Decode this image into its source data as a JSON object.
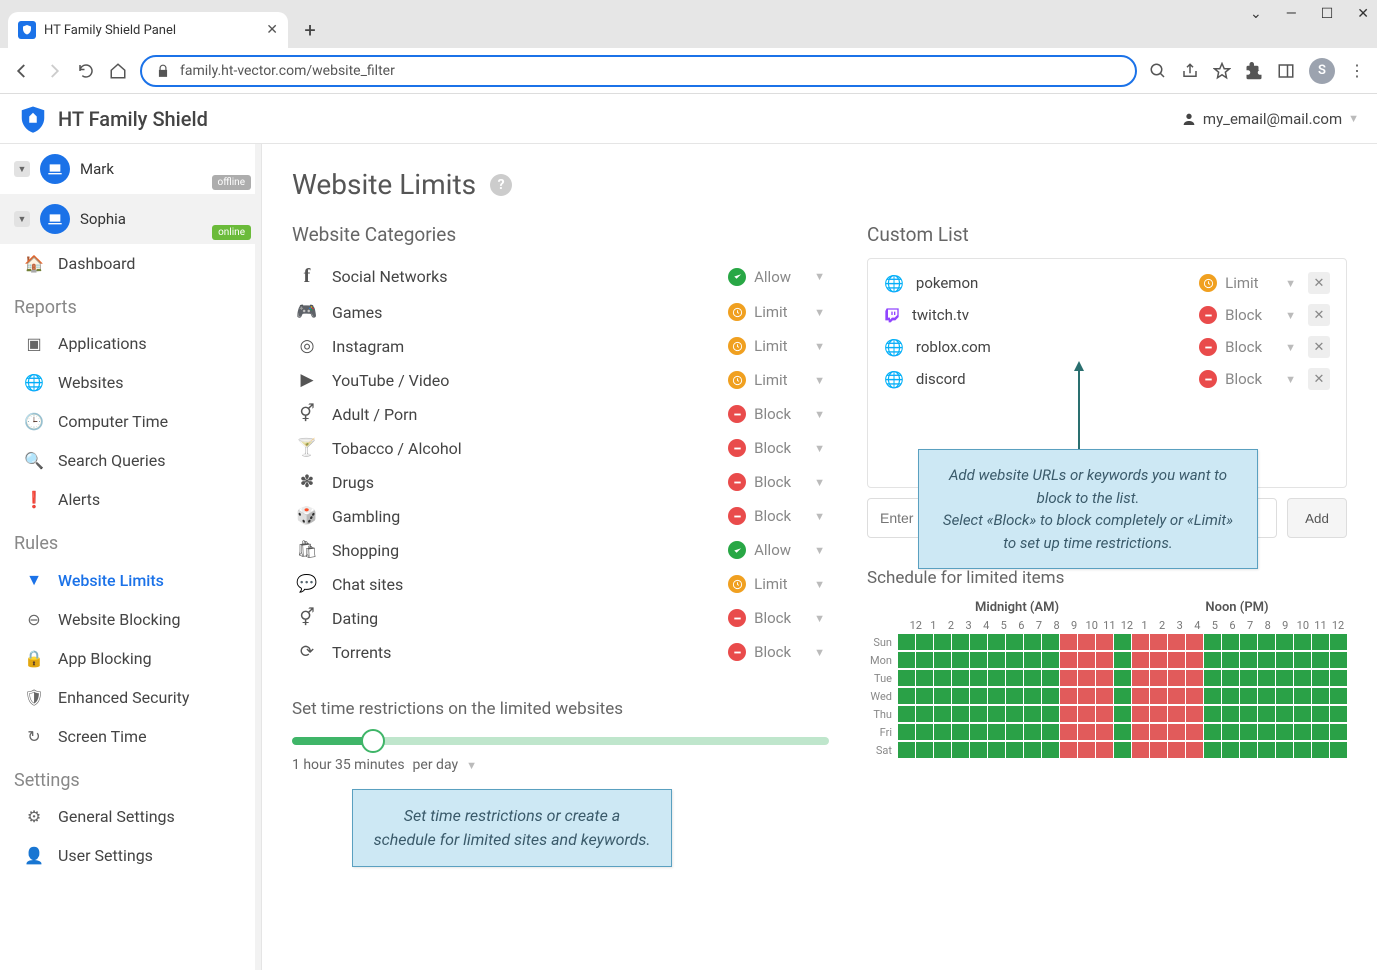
{
  "browser": {
    "tab_title": "HT Family Shield Panel",
    "url": "family.ht-vector.com/website_filter",
    "avatar_letter": "S"
  },
  "header": {
    "brand": "HT Family Shield",
    "email": "my_email@mail.com"
  },
  "profiles": [
    {
      "name": "Mark",
      "status": "offline"
    },
    {
      "name": "Sophia",
      "status": "online"
    }
  ],
  "sidebar": {
    "dashboard": "Dashboard",
    "reports_title": "Reports",
    "reports": [
      "Applications",
      "Websites",
      "Computer Time",
      "Search Queries",
      "Alerts"
    ],
    "rules_title": "Rules",
    "rules": [
      "Website Limits",
      "Website Blocking",
      "App Blocking",
      "Enhanced Security",
      "Screen Time"
    ],
    "settings_title": "Settings",
    "settings": [
      "General Settings",
      "User Settings"
    ]
  },
  "page": {
    "title": "Website Limits",
    "categories_title": "Website Categories",
    "customlist_title": "Custom List",
    "restrict_title": "Set time restrictions on the limited websites",
    "schedule_title": "Schedule for limited items",
    "add_placeholder": "Enter",
    "add_button": "Add",
    "time_value": "1 hour 35 minutes",
    "time_unit": "per day"
  },
  "categories": [
    {
      "label": "Social Networks",
      "status": "Allow",
      "type": "allow"
    },
    {
      "label": "Games",
      "status": "Limit",
      "type": "limit"
    },
    {
      "label": "Instagram",
      "status": "Limit",
      "type": "limit"
    },
    {
      "label": "YouTube / Video",
      "status": "Limit",
      "type": "limit"
    },
    {
      "label": "Adult / Porn",
      "status": "Block",
      "type": "block"
    },
    {
      "label": "Tobacco / Alcohol",
      "status": "Block",
      "type": "block"
    },
    {
      "label": "Drugs",
      "status": "Block",
      "type": "block"
    },
    {
      "label": "Gambling",
      "status": "Block",
      "type": "block"
    },
    {
      "label": "Shopping",
      "status": "Allow",
      "type": "allow"
    },
    {
      "label": "Chat sites",
      "status": "Limit",
      "type": "limit"
    },
    {
      "label": "Dating",
      "status": "Block",
      "type": "block"
    },
    {
      "label": "Torrents",
      "status": "Block",
      "type": "block"
    }
  ],
  "custom_list": [
    {
      "label": "pokemon",
      "status": "Limit",
      "type": "limit",
      "icon": "globe"
    },
    {
      "label": "twitch.tv",
      "status": "Block",
      "type": "block",
      "icon": "twitch"
    },
    {
      "label": "roblox.com",
      "status": "Block",
      "type": "block",
      "icon": "globe"
    },
    {
      "label": "discord",
      "status": "Block",
      "type": "block",
      "icon": "globe"
    }
  ],
  "callouts": {
    "c1": "Add website URLs or keywords you want to block to the list.\nSelect «Block» to block completely or «Limit» to set up time restrictions.",
    "c2": "Set time restrictions or create a schedule for limited sites and keywords."
  },
  "schedule": {
    "left_label": "Midnight (AM)",
    "right_label": "Noon (PM)",
    "hours": [
      "12",
      "1",
      "2",
      "3",
      "4",
      "5",
      "6",
      "7",
      "8",
      "9",
      "10",
      "11",
      "12",
      "1",
      "2",
      "3",
      "4",
      "5",
      "6",
      "7",
      "8",
      "9",
      "10",
      "11",
      "12"
    ],
    "days": [
      "Sun",
      "Mon",
      "Tue",
      "Wed",
      "Thu",
      "Fri",
      "Sat"
    ],
    "red_ranges": [
      [
        9,
        12
      ],
      [
        13,
        17
      ]
    ]
  }
}
